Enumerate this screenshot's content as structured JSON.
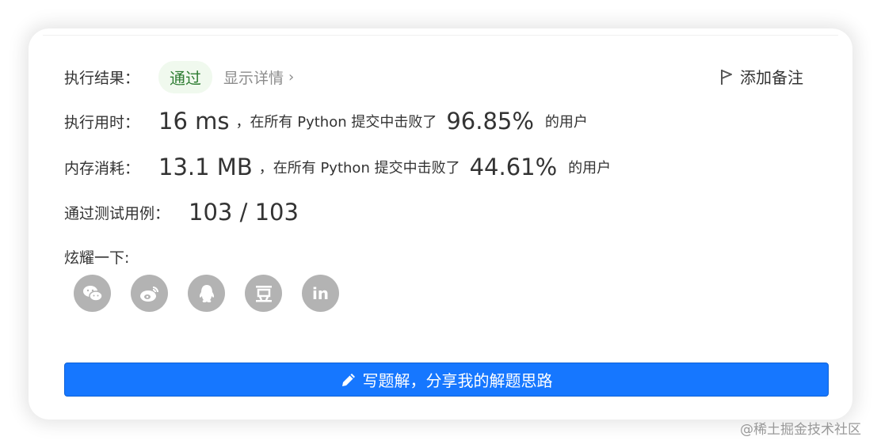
{
  "result": {
    "label": "执行结果：",
    "status": "通过",
    "detail_link": "显示详情",
    "add_note": "添加备注"
  },
  "runtime": {
    "label": "执行用时：",
    "value": "16 ms",
    "mid_text": "，在所有 Python 提交中击败了",
    "percent": "96.85%",
    "suffix": "的用户"
  },
  "memory": {
    "label": "内存消耗：",
    "value": "13.1 MB",
    "mid_text": "，在所有 Python 提交中击败了",
    "percent": "44.61%",
    "suffix": "的用户"
  },
  "testcases": {
    "label": "通过测试用例：",
    "value": "103 / 103"
  },
  "share": {
    "label": "炫耀一下:",
    "icons": [
      "wechat-icon",
      "weibo-icon",
      "qq-icon",
      "douban-icon",
      "linkedin-icon"
    ]
  },
  "submit_button": {
    "label": "写题解，分享我的解题思路",
    "color": "#1677ff"
  },
  "watermark": "@稀土掘金技术社区"
}
